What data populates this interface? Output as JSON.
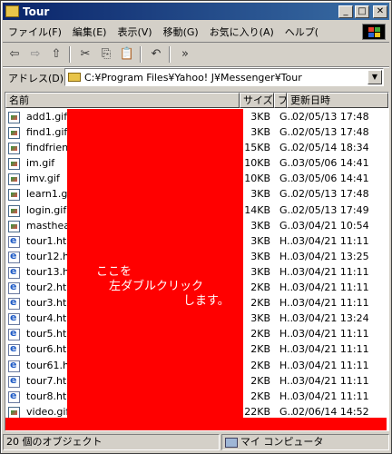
{
  "window": {
    "title": "Tour",
    "minimize": "_",
    "maximize": "□",
    "close": "✕"
  },
  "menu": [
    "ファイル(F)",
    "編集(E)",
    "表示(V)",
    "移動(G)",
    "お気に入り(A)",
    "ヘルプ("
  ],
  "toolbar": {
    "back": "⇦",
    "forward": "⇨",
    "up": "⇧",
    "cut": "✂",
    "copy": "⎘",
    "paste": "📋",
    "undo": "↶",
    "more": "»"
  },
  "addressbar": {
    "label": "アドレス(D)",
    "path": "C:¥Program Files¥Yahoo! J¥Messenger¥Tour"
  },
  "columns": [
    "名前",
    "サイズ",
    "フ",
    "更新日時"
  ],
  "files": [
    {
      "name": "add1.gif",
      "size": "3KB",
      "type": "G..",
      "modified": "02/05/13 17:48",
      "icon": "gif-file-icon"
    },
    {
      "name": "find1.gif",
      "size": "3KB",
      "type": "G..",
      "modified": "02/05/13 17:48",
      "icon": "gif-file-icon"
    },
    {
      "name": "findfriends.gif",
      "size": "15KB",
      "type": "G..",
      "modified": "02/05/14 18:34",
      "icon": "gif-file-icon"
    },
    {
      "name": "im.gif",
      "size": "10KB",
      "type": "G..",
      "modified": "03/05/06 14:41",
      "icon": "gif-file-icon"
    },
    {
      "name": "imv.gif",
      "size": "10KB",
      "type": "G..",
      "modified": "03/05/06 14:41",
      "icon": "gif-file-icon"
    },
    {
      "name": "learn1.gif",
      "size": "3KB",
      "type": "G..",
      "modified": "02/05/13 17:48",
      "icon": "gif-file-icon"
    },
    {
      "name": "login.gif",
      "size": "14KB",
      "type": "G..",
      "modified": "02/05/13 17:49",
      "icon": "gif-file-icon"
    },
    {
      "name": "masthead1.gif",
      "size": "3KB",
      "type": "G..",
      "modified": "03/04/21 10:54",
      "icon": "gif-file-icon"
    },
    {
      "name": "tour1.html",
      "size": "3KB",
      "type": "H..",
      "modified": "03/04/21 11:11",
      "icon": "html-file-icon"
    },
    {
      "name": "tour12.html",
      "size": "3KB",
      "type": "H..",
      "modified": "03/04/21 13:25",
      "icon": "html-file-icon"
    },
    {
      "name": "tour13.html",
      "size": "3KB",
      "type": "H..",
      "modified": "03/04/21 11:11",
      "icon": "html-file-icon"
    },
    {
      "name": "tour2.html",
      "size": "2KB",
      "type": "H..",
      "modified": "03/04/21 11:11",
      "icon": "html-file-icon"
    },
    {
      "name": "tour3.html",
      "size": "2KB",
      "type": "H..",
      "modified": "03/04/21 11:11",
      "icon": "html-file-icon"
    },
    {
      "name": "tour4.html",
      "size": "3KB",
      "type": "H..",
      "modified": "03/04/21 13:24",
      "icon": "html-file-icon"
    },
    {
      "name": "tour5.html",
      "size": "2KB",
      "type": "H..",
      "modified": "03/04/21 11:11",
      "icon": "html-file-icon"
    },
    {
      "name": "tour6.html",
      "size": "2KB",
      "type": "H..",
      "modified": "03/04/21 11:11",
      "icon": "html-file-icon"
    },
    {
      "name": "tour61.html",
      "size": "2KB",
      "type": "H..",
      "modified": "03/04/21 11:11",
      "icon": "html-file-icon"
    },
    {
      "name": "tour7.html",
      "size": "2KB",
      "type": "H..",
      "modified": "03/04/21 11:11",
      "icon": "html-file-icon"
    },
    {
      "name": "tour8.html",
      "size": "2KB",
      "type": "H..",
      "modified": "03/04/21 11:11",
      "icon": "html-file-icon"
    },
    {
      "name": "video.gif",
      "size": "22KB",
      "type": "G..",
      "modified": "02/06/14 14:52",
      "icon": "gif-file-icon"
    }
  ],
  "annotation": {
    "line1": "ここを",
    "line2": "左ダブルクリック",
    "line3": "します。",
    "color": "#ff0000"
  },
  "status": {
    "objects": "20 個のオブジェクト",
    "location": "マイ コンピュータ"
  }
}
